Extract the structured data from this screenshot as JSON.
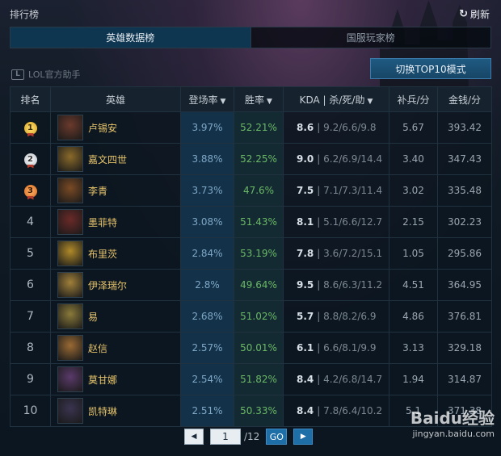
{
  "header": {
    "title": "排行榜",
    "refresh_label": "刷新"
  },
  "tabs": [
    {
      "label": "英雄数据榜",
      "active": true
    },
    {
      "label": "国服玩家榜",
      "active": false
    }
  ],
  "brand": {
    "label": "LOL官方助手"
  },
  "mode_button": {
    "label": "切换TOP10模式"
  },
  "table": {
    "headers": [
      "排名",
      "英雄",
      "登场率",
      "胜率",
      "KDA | 杀/死/助",
      "补兵/分",
      "金钱/分"
    ],
    "sortable_headers": [
      2,
      3,
      4
    ],
    "rows": [
      {
        "rank": "1",
        "medal": "gold",
        "hero": "卢锡安",
        "pick_rate": "3.97%",
        "win_rate": "52.21%",
        "kda": "8.6",
        "kda_detail": "9.2/6.6/9.8",
        "cs": "5.67",
        "gold": "393.42",
        "avatar_color": "#6b3a2c"
      },
      {
        "rank": "2",
        "medal": "silver",
        "hero": "嘉文四世",
        "pick_rate": "3.88%",
        "win_rate": "52.25%",
        "kda": "9.0",
        "kda_detail": "6.2/6.9/14.4",
        "cs": "3.40",
        "gold": "347.43",
        "avatar_color": "#8a6a2a"
      },
      {
        "rank": "3",
        "medal": "bronze",
        "hero": "李青",
        "pick_rate": "3.73%",
        "win_rate": "47.6%",
        "kda": "7.5",
        "kda_detail": "7.1/7.3/11.4",
        "cs": "3.02",
        "gold": "335.48",
        "avatar_color": "#7a4a24"
      },
      {
        "rank": "4",
        "medal": "",
        "hero": "墨菲特",
        "pick_rate": "3.08%",
        "win_rate": "51.43%",
        "kda": "8.1",
        "kda_detail": "5.1/6.6/12.7",
        "cs": "2.15",
        "gold": "302.23",
        "avatar_color": "#6a2a28"
      },
      {
        "rank": "5",
        "medal": "",
        "hero": "布里茨",
        "pick_rate": "2.84%",
        "win_rate": "53.19%",
        "kda": "7.8",
        "kda_detail": "3.6/7.2/15.1",
        "cs": "1.05",
        "gold": "295.86",
        "avatar_color": "#b08a2a"
      },
      {
        "rank": "6",
        "medal": "",
        "hero": "伊泽瑞尔",
        "pick_rate": "2.8%",
        "win_rate": "49.64%",
        "kda": "9.5",
        "kda_detail": "8.6/6.3/11.2",
        "cs": "4.51",
        "gold": "364.95",
        "avatar_color": "#a0803a"
      },
      {
        "rank": "7",
        "medal": "",
        "hero": "易",
        "pick_rate": "2.68%",
        "win_rate": "51.02%",
        "kda": "5.7",
        "kda_detail": "8.8/8.2/6.9",
        "cs": "4.86",
        "gold": "376.81",
        "avatar_color": "#8a7a3a"
      },
      {
        "rank": "8",
        "medal": "",
        "hero": "赵信",
        "pick_rate": "2.57%",
        "win_rate": "50.01%",
        "kda": "6.1",
        "kda_detail": "6.6/8.1/9.9",
        "cs": "3.13",
        "gold": "329.18",
        "avatar_color": "#9a6a34"
      },
      {
        "rank": "9",
        "medal": "",
        "hero": "莫甘娜",
        "pick_rate": "2.54%",
        "win_rate": "51.82%",
        "kda": "8.4",
        "kda_detail": "4.2/6.8/14.7",
        "cs": "1.94",
        "gold": "314.87",
        "avatar_color": "#5a3a6a"
      },
      {
        "rank": "10",
        "medal": "",
        "hero": "凯特琳",
        "pick_rate": "2.51%",
        "win_rate": "50.33%",
        "kda": "8.4",
        "kda_detail": "7.8/6.4/10.2",
        "cs": "5.1",
        "gold": "371.38",
        "avatar_color": "#3a3450"
      }
    ]
  },
  "pager": {
    "current_page": "1",
    "total_label": "/12",
    "go_label": "GO"
  },
  "watermark": {
    "logo": "Baidu经验",
    "url": "jingyan.baidu.com"
  }
}
